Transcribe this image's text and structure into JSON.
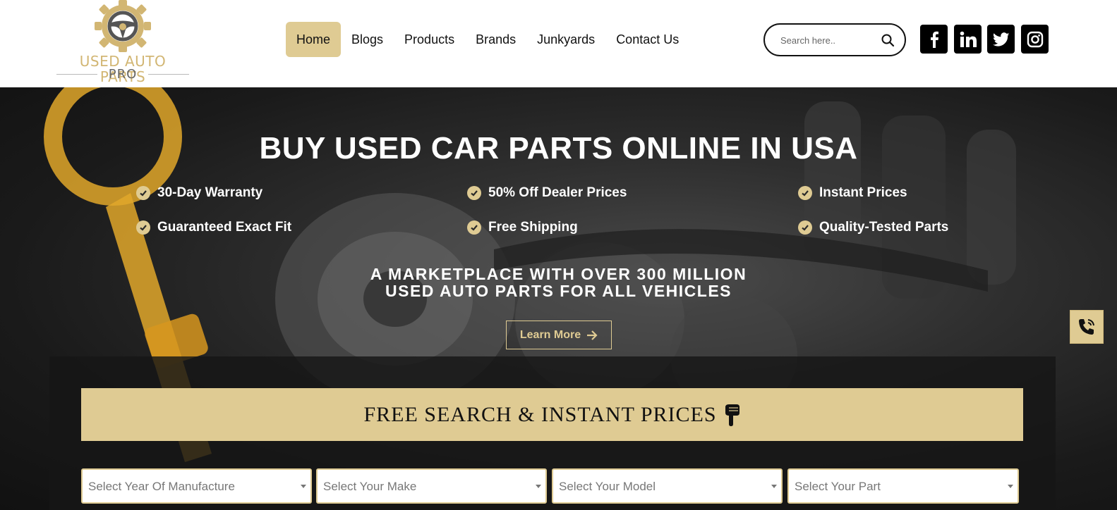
{
  "brand": {
    "name_line1": "USED AUTO PARTS",
    "name_line2": "PRO",
    "gold": "#d2b673",
    "accent": "#dfcb93"
  },
  "nav": {
    "items": [
      {
        "label": "Home",
        "active": true
      },
      {
        "label": "Blogs"
      },
      {
        "label": "Products"
      },
      {
        "label": "Brands"
      },
      {
        "label": "Junkyards"
      },
      {
        "label": "Contact Us"
      }
    ]
  },
  "search": {
    "placeholder": "Search here..",
    "icon": "search-icon"
  },
  "social": [
    "facebook-icon",
    "linkedin-icon",
    "twitter-icon",
    "instagram-icon"
  ],
  "hero": {
    "title": "BUY USED CAR PARTS ONLINE IN USA",
    "features": [
      "30-Day Warranty",
      "50% Off Dealer Prices",
      "Instant Prices",
      "Guaranteed Exact Fit",
      "Free Shipping",
      "Quality-Tested Parts"
    ],
    "subtitle_line1": "A MARKETPLACE WITH OVER 300 MILLION",
    "subtitle_line2": "USED AUTO PARTS FOR ALL VEHICLES",
    "cta_label": "Learn More"
  },
  "finder": {
    "banner": "FREE SEARCH & INSTANT PRICES",
    "selects": [
      "Select Year Of Manufacture",
      "Select Your Make",
      "Select Your Model",
      "Select Your Part"
    ]
  }
}
